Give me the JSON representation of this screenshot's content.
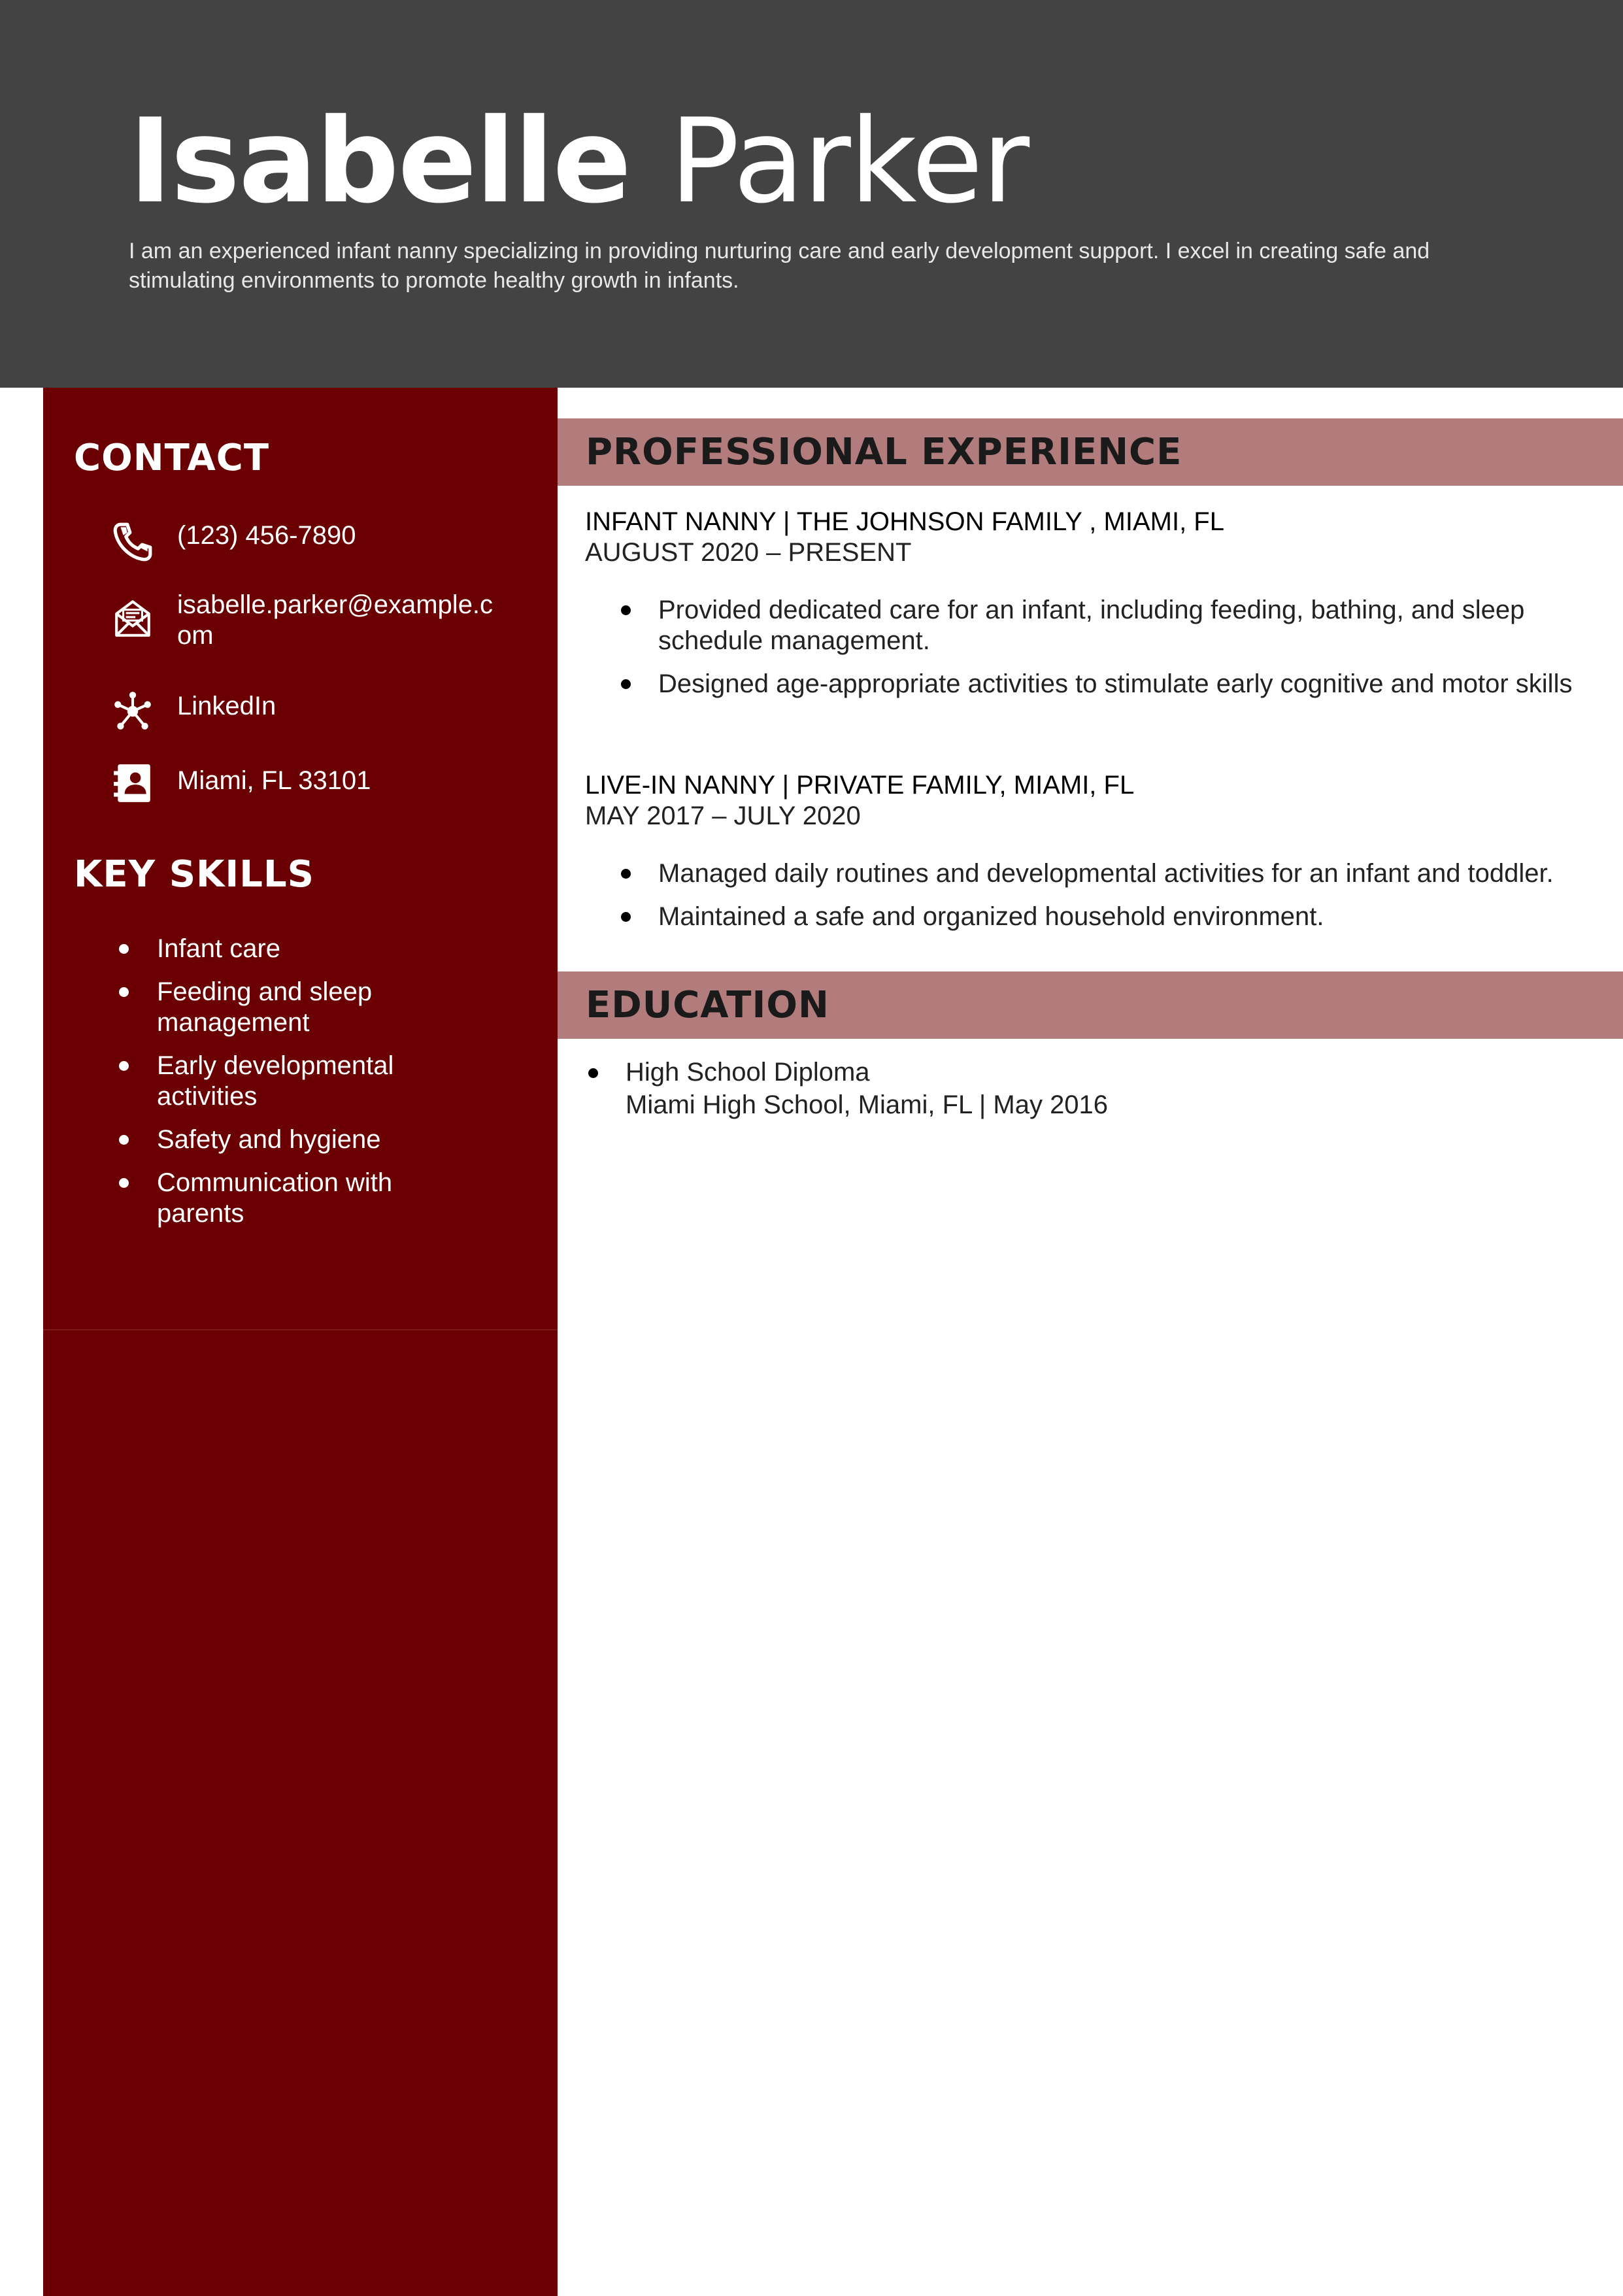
{
  "header": {
    "first_name": "Isabelle",
    "last_name": "Parker",
    "summary": "I am an experienced infant nanny specializing in providing nurturing care and early development support. I excel in creating safe and stimulating environments to promote healthy growth in infants."
  },
  "contact": {
    "heading": "CONTACT",
    "items": [
      {
        "icon": "phone-icon",
        "text": "(123) 456-7890"
      },
      {
        "icon": "envelope-icon",
        "text": "isabelle.parker@example.com"
      },
      {
        "icon": "network-icon",
        "text": "LinkedIn"
      },
      {
        "icon": "address-card-icon",
        "text": "Miami, FL 33101"
      }
    ]
  },
  "skills": {
    "heading": "KEY SKILLS",
    "items": [
      "Infant care",
      "Feeding and sleep management",
      "Early developmental activities",
      "Safety and hygiene",
      "Communication with parents"
    ]
  },
  "experience": {
    "heading": "PROFESSIONAL EXPERIENCE",
    "jobs": [
      {
        "title": "INFANT NANNY  | THE JOHNSON FAMILY , MIAMI, FL",
        "dates": "AUGUST 2020 – PRESENT",
        "bullets": [
          "Provided dedicated care for an infant, including feeding, bathing, and sleep schedule management.",
          "Designed age-appropriate activities to stimulate early cognitive and motor skills"
        ]
      },
      {
        "title": "LIVE-IN NANNY | PRIVATE FAMILY, MIAMI, FL",
        "dates": "MAY 2017 – JULY 2020",
        "bullets": [
          "Managed daily routines and developmental activities for an infant and toddler.",
          "Maintained a safe and organized household environment."
        ]
      }
    ]
  },
  "education": {
    "heading": "EDUCATION",
    "degree": "High School Diploma",
    "details": "Miami High School, Miami, FL | May 2016"
  },
  "colors": {
    "header_bg": "#434343",
    "sidebar_bg": "#6a0001",
    "section_bar": "#b37c7c"
  }
}
